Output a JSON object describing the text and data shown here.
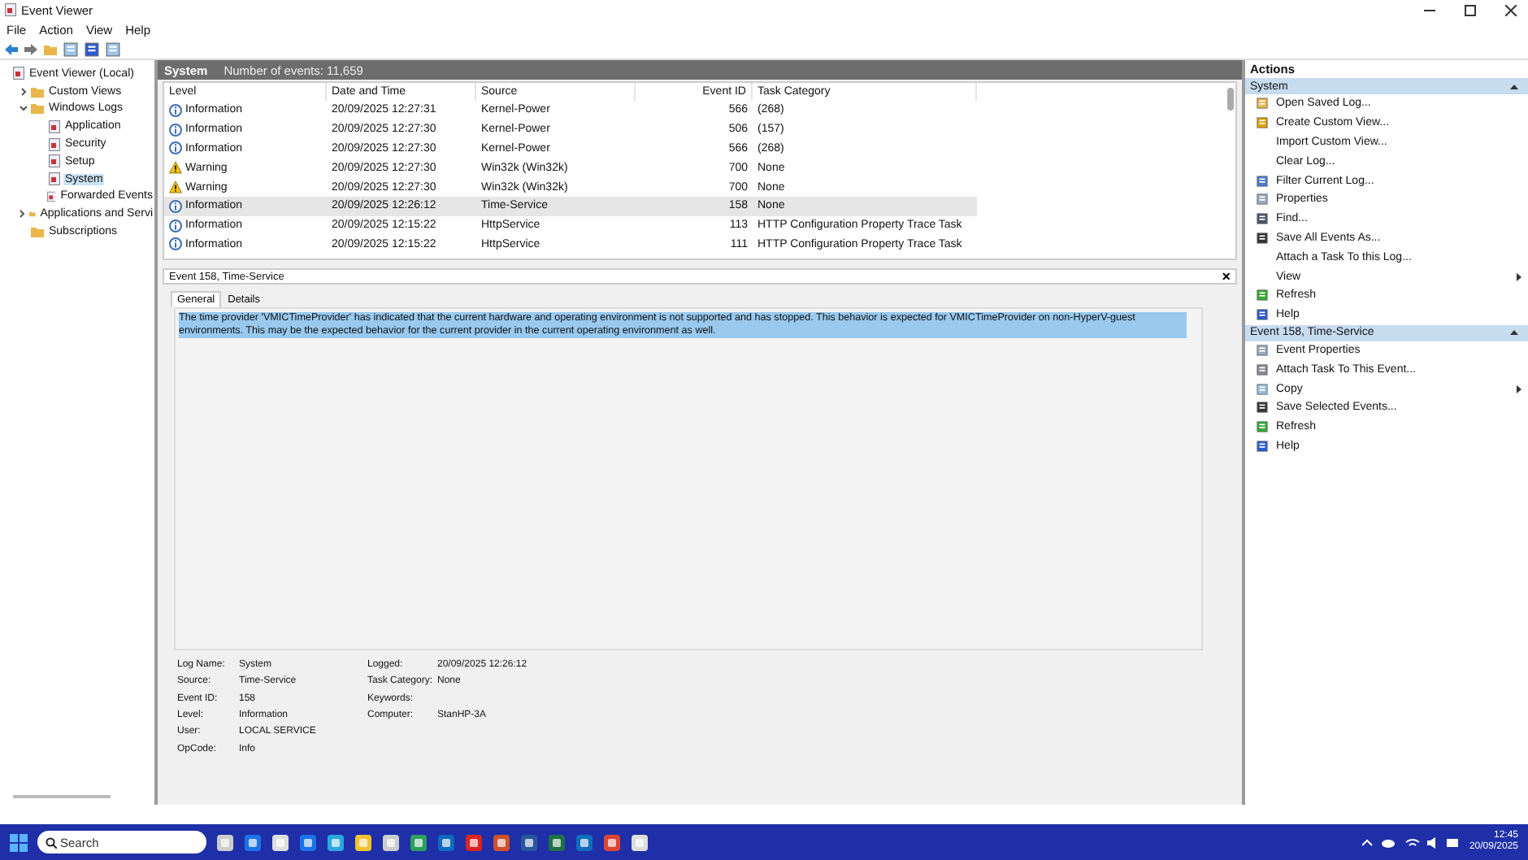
{
  "window": {
    "title": "Event Viewer"
  },
  "menu": [
    "File",
    "Action",
    "View",
    "Help"
  ],
  "tree": [
    {
      "label": "Event Viewer (Local)",
      "selected": false,
      "children": [
        {
          "label": "Custom Views",
          "selected": false,
          "expanded": false
        },
        {
          "label": "Windows Logs",
          "selected": false,
          "expanded": true,
          "children": [
            {
              "label": "Application",
              "selected": false
            },
            {
              "label": "Security",
              "selected": false
            },
            {
              "label": "Setup",
              "selected": false
            },
            {
              "label": "System",
              "selected": true
            },
            {
              "label": "Forwarded Events",
              "selected": false
            }
          ]
        },
        {
          "label": "Applications and Servi",
          "selected": false,
          "expanded": false
        },
        {
          "label": "Subscriptions",
          "selected": false
        }
      ]
    }
  ],
  "log_header": {
    "title": "System",
    "count": "Number of events: 11,659"
  },
  "table": {
    "columns": [
      "Level",
      "Date and Time",
      "Source",
      "Event ID",
      "Task Category"
    ],
    "rows": [
      {
        "kind": "information",
        "selected": false,
        "cells": [
          "Information",
          "20/09/2025 12:27:31",
          "Kernel-Power",
          "566",
          "(268)"
        ]
      },
      {
        "kind": "information",
        "selected": false,
        "cells": [
          "Information",
          "20/09/2025 12:27:30",
          "Kernel-Power",
          "506",
          "(157)"
        ]
      },
      {
        "kind": "information",
        "selected": false,
        "cells": [
          "Information",
          "20/09/2025 12:27:30",
          "Kernel-Power",
          "566",
          "(268)"
        ]
      },
      {
        "kind": "warning",
        "selected": false,
        "cells": [
          "Warning",
          "20/09/2025 12:27:30",
          "Win32k (Win32k)",
          "700",
          "None"
        ]
      },
      {
        "kind": "warning",
        "selected": false,
        "cells": [
          "Warning",
          "20/09/2025 12:27:30",
          "Win32k (Win32k)",
          "700",
          "None"
        ]
      },
      {
        "kind": "information",
        "selected": true,
        "cells": [
          "Information",
          "20/09/2025 12:26:12",
          "Time-Service",
          "158",
          "None"
        ]
      },
      {
        "kind": "information",
        "selected": false,
        "cells": [
          "Information",
          "20/09/2025 12:15:22",
          "HttpService",
          "113",
          "HTTP Configuration Property Trace Task"
        ]
      },
      {
        "kind": "information",
        "selected": false,
        "cells": [
          "Information",
          "20/09/2025 12:15:22",
          "HttpService",
          "111",
          "HTTP Configuration Property Trace Task"
        ]
      }
    ]
  },
  "detail": {
    "title": "Event 158, Time-Service",
    "close": "×",
    "tabs": [
      {
        "label": "General",
        "selected": true
      },
      {
        "label": "Details",
        "selected": false
      }
    ],
    "description": "The time provider 'VMICTimeProvider' has indicated that the current hardware and operating environment is not supported and has stopped. This behavior is expected for VMICTimeProvider on non-HyperV-guest environments. This may be the expected behavior for the current provider in the current operating environment as well.",
    "fields_left": [
      {
        "label": "Log Name:",
        "value": "System"
      },
      {
        "label": "Source:",
        "value": "Time-Service"
      },
      {
        "label": "Event ID:",
        "value": "158"
      },
      {
        "label": "Level:",
        "value": "Information"
      },
      {
        "label": "User:",
        "value": "LOCAL SERVICE"
      },
      {
        "label": "OpCode:",
        "value": "Info"
      }
    ],
    "fields_right": [
      {
        "label": "Logged:",
        "value": "20/09/2025 12:26:12"
      },
      {
        "label": "Task Category:",
        "value": "None"
      },
      {
        "label": "Keywords:"
      },
      {
        "label": "Computer:",
        "value": "StanHP-3A"
      }
    ]
  },
  "actions": {
    "title": "Actions",
    "sections": [
      {
        "title": "System",
        "items": [
          {
            "label": "Open Saved Log...",
            "submenu": false
          },
          {
            "label": "Create Custom View...",
            "submenu": false
          },
          {
            "label": "Import Custom View...",
            "submenu": false
          },
          {
            "label": "Clear Log...",
            "submenu": false
          },
          {
            "label": "Filter Current Log...",
            "submenu": false
          },
          {
            "label": "Properties",
            "submenu": false
          },
          {
            "label": "Find...",
            "submenu": false
          },
          {
            "label": "Save All Events As...",
            "submenu": false
          },
          {
            "label": "Attach a Task To this Log...",
            "submenu": false
          },
          {
            "label": "View",
            "submenu": true
          },
          {
            "label": "Refresh",
            "submenu": false
          },
          {
            "label": "Help",
            "submenu": false
          }
        ]
      },
      {
        "title": "Event 158, Time-Service",
        "items": [
          {
            "label": "Event Properties",
            "submenu": false
          },
          {
            "label": "Attach Task To This Event...",
            "submenu": false
          },
          {
            "label": "Copy",
            "submenu": true
          },
          {
            "label": "Save Selected Events...",
            "submenu": false
          },
          {
            "label": "Refresh",
            "submenu": false
          },
          {
            "label": "Help",
            "submenu": false
          }
        ]
      }
    ]
  },
  "taskbar": {
    "search_placeholder": "Search",
    "time": "12:45",
    "date": "20/09/2025"
  }
}
